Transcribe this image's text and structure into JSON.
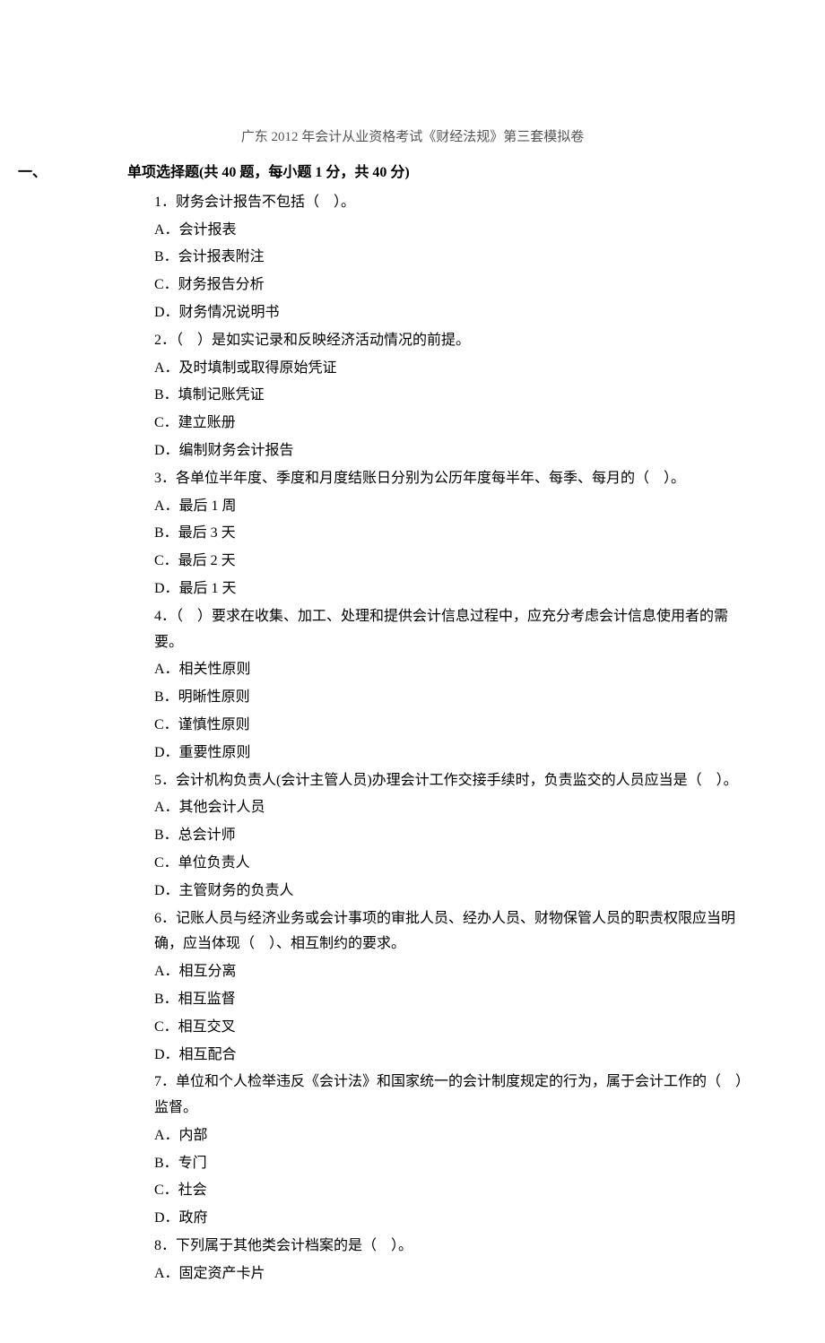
{
  "title": "广东 2012 年会计从业资格考试《财经法规》第三套模拟卷",
  "section": {
    "num": "一、",
    "heading": "单项选择题(共 40 题，每小题 1 分，共 40 分)"
  },
  "questions": [
    {
      "stem": "1．财务会计报告不包括（　）。",
      "options": [
        "A．会计报表",
        "B．会计报表附注",
        "C．财务报告分析",
        "D．财务情况说明书"
      ]
    },
    {
      "stem": "2．（　）是如实记录和反映经济活动情况的前提。",
      "options": [
        "A．及时填制或取得原始凭证",
        "B．填制记账凭证",
        "C．建立账册",
        "D．编制财务会计报告"
      ]
    },
    {
      "stem": "3．各单位半年度、季度和月度结账日分别为公历年度每半年、每季、每月的（　）。",
      "options": [
        "A．最后 1 周",
        "B．最后 3 天",
        "C．最后 2 天",
        "D．最后 1 天"
      ]
    },
    {
      "stem": "4．（　）要求在收集、加工、处理和提供会计信息过程中，应充分考虑会计信息使用者的需要。",
      "options": [
        "A．相关性原则",
        "B．明晰性原则",
        "C．谨慎性原则",
        "D．重要性原则"
      ]
    },
    {
      "stem": "5．会计机构负责人(会计主管人员)办理会计工作交接手续时，负责监交的人员应当是（　）。",
      "options": [
        "A．其他会计人员",
        "B．总会计师",
        "C．单位负责人",
        "D．主管财务的负责人"
      ]
    },
    {
      "stem": "6．记账人员与经济业务或会计事项的审批人员、经办人员、财物保管人员的职责权限应当明确，应当体现（　）、相互制约的要求。",
      "options": [
        "A．相互分离",
        "B．相互监督",
        "C．相互交叉",
        "D．相互配合"
      ]
    },
    {
      "stem": "7．单位和个人检举违反《会计法》和国家统一的会计制度规定的行为，属于会计工作的（　）监督。",
      "options": [
        "A．内部",
        "B．专门",
        "C．社会",
        "D．政府"
      ]
    },
    {
      "stem": "8．下列属于其他类会计档案的是（　）。",
      "options": [
        "A．固定资产卡片"
      ]
    }
  ]
}
